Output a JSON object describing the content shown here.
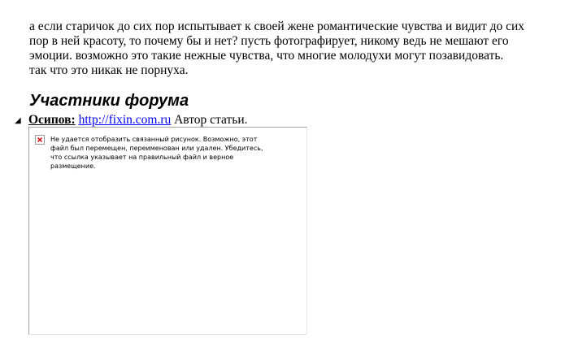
{
  "article": {
    "paragraph_lines": [
      "а если старичок до сих пор испытывает к своей жене романтические чувства и видит до сих",
      "пор в ней красоту, то почему бы и нет? пусть фотографирует, никому ведь не мешают его",
      "эмоции. возможно это такие нежные чувства, что многие молодухи могут позавидовать.",
      "так что это никак не порнуха."
    ]
  },
  "section": {
    "heading": "Участники форума"
  },
  "participant": {
    "toggle_icon": "◢",
    "name": "Осипов:",
    "link_text": "http://fixin.com.ru",
    "suffix": " Автор статьи."
  },
  "broken_image": {
    "icon": "broken-image-icon",
    "icon_color": "#cc0000",
    "message_lines": [
      "Не удается отобразить связанный рисунок. Возможно, этот",
      "файл был перемещен, переименован или удален. Убедитесь,",
      "что ссылка указывает на правильный файл и верное",
      "размещение."
    ]
  }
}
